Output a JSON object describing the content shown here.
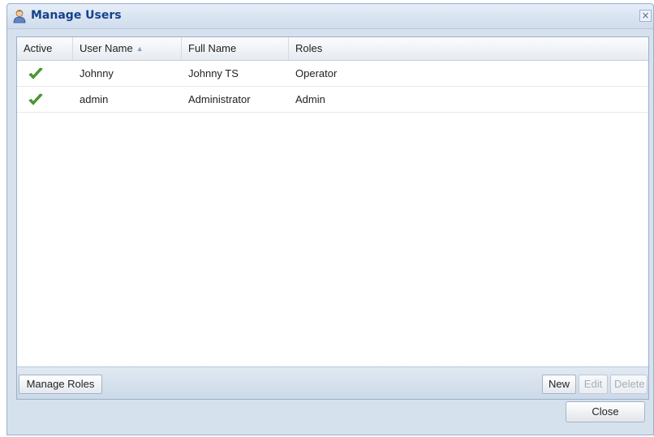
{
  "window": {
    "title": "Manage Users",
    "title_icon": "user-icon",
    "close_icon": "close-icon",
    "close_glyph": "×"
  },
  "grid": {
    "columns": [
      {
        "label": "Active"
      },
      {
        "label": "User Name",
        "sort": "ascending",
        "sort_glyph": "▲"
      },
      {
        "label": "Full Name"
      },
      {
        "label": "Roles"
      }
    ],
    "rows": [
      {
        "active": true,
        "active_icon": "checkmark-icon",
        "user_name": "Johnny",
        "full_name": "Johnny TS",
        "roles": "Operator"
      },
      {
        "active": true,
        "active_icon": "checkmark-icon",
        "user_name": "admin",
        "full_name": "Administrator",
        "roles": "Admin"
      }
    ]
  },
  "toolbar": {
    "manage_roles_label": "Manage Roles",
    "new_label": "New",
    "edit_label": "Edit",
    "delete_label": "Delete"
  },
  "footer": {
    "close_label": "Close"
  },
  "colors": {
    "title_text": "#15428b",
    "check_green": "#4aa830",
    "window_bg": "#d6e1ee"
  }
}
